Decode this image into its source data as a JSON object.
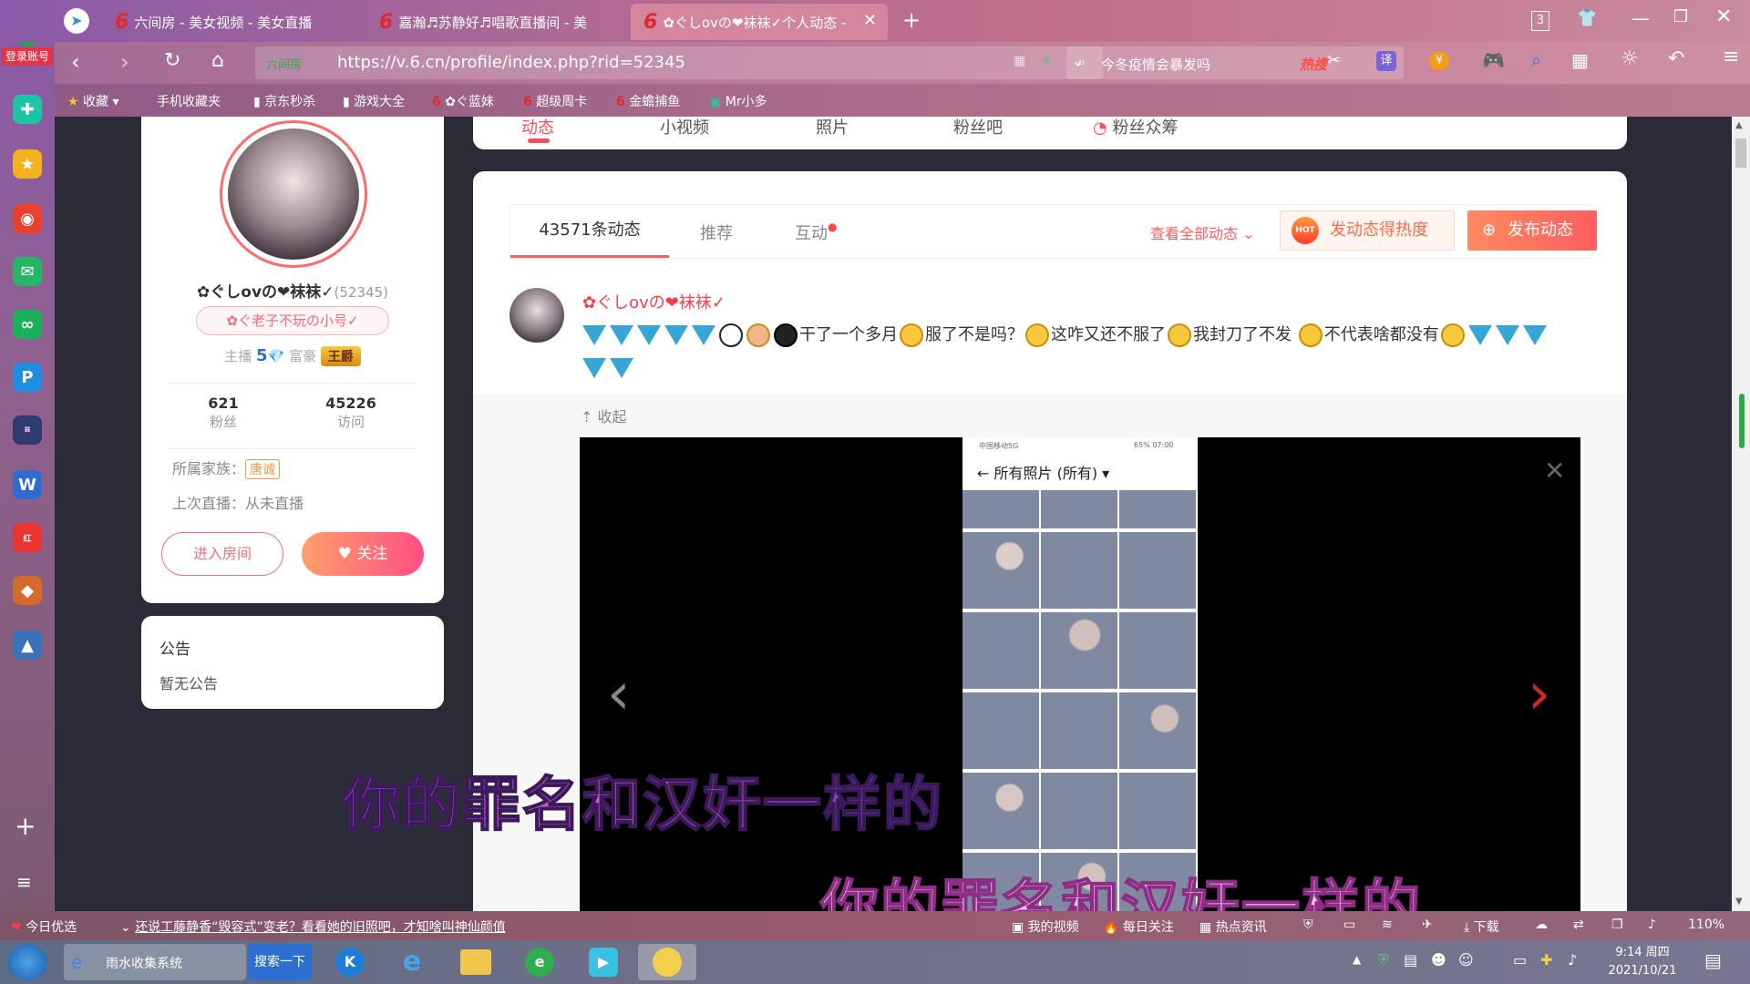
{
  "browser": {
    "login_label": "登录账号",
    "tabs": [
      {
        "title": "六间房 - 美女视频 - 美女直播"
      },
      {
        "title": "嘉瀚♬苏静好♬唱歌直播间 - 美"
      },
      {
        "title": "✿ぐしovの❤袜袜✓个人动态 - "
      }
    ],
    "tab_count": "3",
    "url_prefix": "六间房",
    "url": "https://v.6.cn/profile/index.php?rid=52345",
    "search_text": "今冬疫情会暴发吗",
    "hot_label": "热搜",
    "translate_label": "译",
    "bookmarks": [
      "收藏",
      "手机收藏夹",
      "京东秒杀",
      "游戏大全",
      "✿ぐ蓝妹",
      "超级周卡",
      "金蟾捕鱼",
      "Mr小多"
    ]
  },
  "profile": {
    "top_tabs": [
      "动态",
      "小视频",
      "照片",
      "粉丝吧",
      "粉丝众筹"
    ],
    "name": "✿ぐしovの❤袜袜✓",
    "rid": "(52345)",
    "nickname_badge": "✿ぐ老子不玩の小号✓",
    "anchor_label": "主播",
    "anchor_level": "5",
    "rich_label": "富豪",
    "rich_badge": "王爵",
    "fans_count": "621",
    "fans_label": "粉丝",
    "visits_count": "45226",
    "visits_label": "访问",
    "family_label": "所属家族：",
    "family_name": "唐诚",
    "last_live": "上次直播：从未直播",
    "enter_room": "进入房间",
    "follow": "关注",
    "notice_title": "公告",
    "notice_text": "暂无公告"
  },
  "feed": {
    "tab_all": "43571条动态",
    "tab_recommend": "推荐",
    "tab_interact": "互动",
    "view_all": "查看全部动态",
    "heat_button": "发动态得热度",
    "hot_badge": "HOT",
    "publish_button": "发布动态",
    "post_author": "✿ぐしovの❤袜袜✓",
    "post_segments": [
      "干了一个多月",
      "服了不是吗？",
      "这咋又还不服了",
      "我封刀了不发",
      "不代表啥都没有"
    ],
    "collapse": "收起",
    "phone_title": "所有照片 (所有)",
    "phone_status_left": "中国移动5G",
    "phone_status_right": "65% 07:00"
  },
  "subtitles": {
    "line1": "你的罪名和汉奸一样的",
    "line2": "你的罪名和汉奸一样的"
  },
  "statusbar": {
    "daily": "今日优选",
    "news": "还说工藤静香“毁容式”变老？看看她的旧照吧，才知啥叫神仙颜值",
    "my_video": "我的视频",
    "daily_follow": "每日关注",
    "hot_news": "热点资讯",
    "download": "下载",
    "zoom": "110%"
  },
  "taskbar": {
    "app1": "雨水收集系统",
    "app1_button": "搜索一下",
    "time": "9:14 周四",
    "date": "2021/10/21"
  },
  "colors": {
    "accent": "#ff5a5f",
    "brand_red": "#e02a2a",
    "follow_gradient_start": "#ff8a6b",
    "follow_gradient_end": "#ff4f82"
  }
}
